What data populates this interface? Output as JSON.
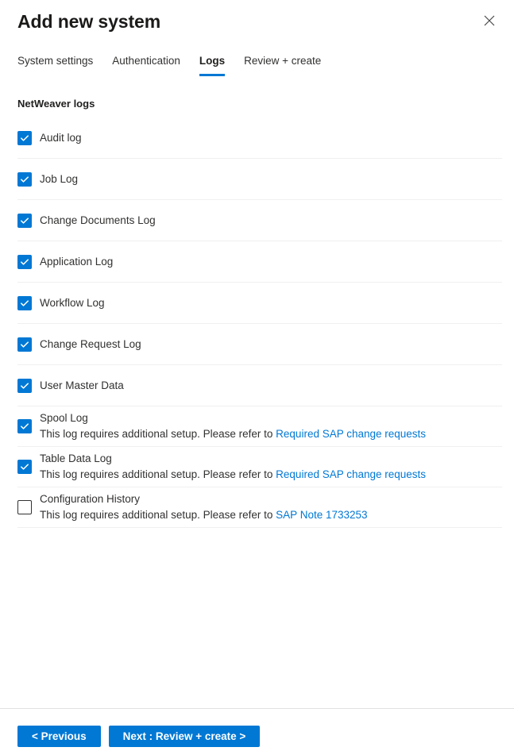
{
  "header": {
    "title": "Add new system",
    "close_icon": "close-icon"
  },
  "tabs": [
    {
      "label": "System settings",
      "active": false
    },
    {
      "label": "Authentication",
      "active": false
    },
    {
      "label": "Logs",
      "active": true
    },
    {
      "label": "Review + create",
      "active": false
    }
  ],
  "main": {
    "section_title": "NetWeaver logs",
    "logs": [
      {
        "label": "Audit log",
        "checked": true,
        "note": "",
        "link": ""
      },
      {
        "label": "Job Log",
        "checked": true,
        "note": "",
        "link": ""
      },
      {
        "label": "Change Documents Log",
        "checked": true,
        "note": "",
        "link": ""
      },
      {
        "label": "Application Log",
        "checked": true,
        "note": "",
        "link": ""
      },
      {
        "label": "Workflow Log",
        "checked": true,
        "note": "",
        "link": ""
      },
      {
        "label": "Change Request Log",
        "checked": true,
        "note": "",
        "link": ""
      },
      {
        "label": "User Master Data",
        "checked": true,
        "note": "",
        "link": ""
      },
      {
        "label": "Spool Log",
        "checked": true,
        "note": "This log requires additional setup. Please refer to ",
        "link": "Required SAP change requests"
      },
      {
        "label": "Table Data Log",
        "checked": true,
        "note": "This log requires additional setup. Please refer to ",
        "link": "Required SAP change requests"
      },
      {
        "label": "Configuration History",
        "checked": false,
        "note": "This log requires additional setup. Please refer to ",
        "link": "SAP Note 1733253"
      }
    ]
  },
  "footer": {
    "previous_label": "< Previous",
    "next_label": "Next : Review + create >"
  },
  "colors": {
    "accent": "#0078d4",
    "text": "#323130",
    "divider": "#f0f0f0",
    "footer_divider": "#e1e1e1"
  }
}
